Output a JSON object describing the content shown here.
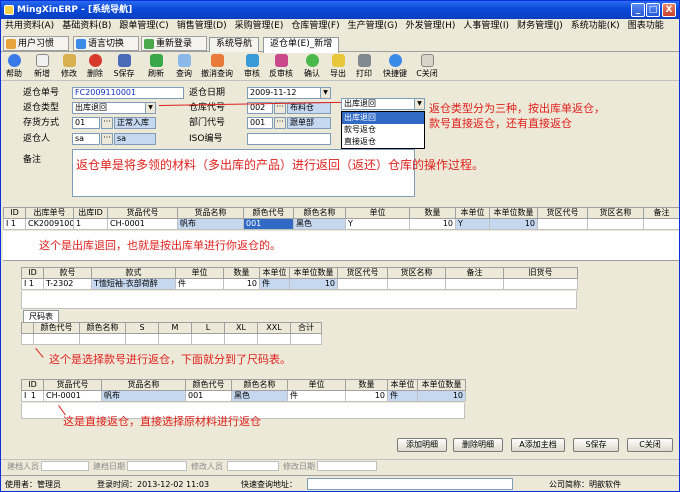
{
  "window": {
    "title": "MingXinERP - [系统导航]",
    "minimize": "_",
    "maximize": "□",
    "close": "X"
  },
  "menu": [
    "共用资料(A)",
    "基础资料(B)",
    "跟单管理(C)",
    "销售管理(D)",
    "采购管理(E)",
    "仓库管理(F)",
    "生产管理(G)",
    "外发管理(H)",
    "人事管理(I)",
    "财务管理(J)",
    "系统功能(K)",
    "图表功能"
  ],
  "quickbar": {
    "user_habit": "用户习惯",
    "language": "语言切换",
    "relogin": "重新登录"
  },
  "tabs": [
    "系统导航",
    "返仓单(E)_新增"
  ],
  "toolbar": [
    "帮助",
    "新增",
    "修改",
    "删除",
    "S保存",
    "刷新",
    "查询",
    "撤消查询",
    "审核",
    "反审核",
    "确认",
    "导出",
    "打印",
    "快捷键",
    "C关闭"
  ],
  "form": {
    "return_no_label": "返仓单号",
    "return_no": "FC2009110001",
    "return_date_label": "返仓日期",
    "return_date": "2009-11-12",
    "type_label": "返仓类型",
    "type_value": "出库退回",
    "warehouse_label": "仓库代号",
    "warehouse_code": "002",
    "warehouse_name": "布料仓",
    "stock_label": "存货方式",
    "stock_code": "01",
    "stock_name": "正常入库",
    "dept_label": "部门代号",
    "dept_code": "001",
    "dept_name": "跟单部",
    "person_label": "返仓人",
    "person_code": "sa",
    "person_name": "sa",
    "iso_label": "ISO编号",
    "iso_value": "",
    "remark_label": "备注"
  },
  "dropdown": {
    "selected": "出库退回",
    "options": [
      "出库退回",
      "款号返仓",
      "直接返仓"
    ]
  },
  "notes": {
    "type_info_1": "返仓类型分为三种，按出库单返仓，",
    "type_info_2": "款号直接返仓，还有直接返仓",
    "remark_info": "返仓单是将多领的材料（多出库的产品）进行返回（返还）仓库的操作过程。",
    "grid1_info": "这个是出库退回，也就是按出库单进行你返仓的。",
    "size_info": "这个是选择款号进行返仓，下面就分到了尺码表。",
    "grid3_info": "这是直接返仓，直接选择原材料进行返仓"
  },
  "grid1": {
    "headers": [
      "ID",
      "出库单号",
      "出库ID",
      "货品代号",
      "货品名称",
      "颜色代号",
      "颜色名称",
      "单位",
      "数量",
      "本单位",
      "本单位数量",
      "货区代号",
      "货区名称",
      "备注"
    ],
    "row": {
      "indicator": "I",
      "id": "1",
      "out_no": "CK2009100001",
      "out_id": "1",
      "code": "CH-0001",
      "name": "帆布",
      "color_code": "001",
      "color_name": "黑色",
      "unit": "Y",
      "qty": "10",
      "base_unit": "Y",
      "base_qty": "10",
      "area_code": "",
      "area_name": "",
      "remark": ""
    }
  },
  "grid2": {
    "headers": [
      "ID",
      "款号",
      "款式",
      "单位",
      "数量",
      "本单位",
      "本单位数量",
      "货区代号",
      "货区名称",
      "备注",
      "旧货号"
    ],
    "row": {
      "indicator": "I",
      "id": "1",
      "style_no": "T-2302",
      "style": "T恤短袖-衣部荷醉",
      "unit": "件",
      "qty": "10",
      "base_unit": "件",
      "base_qty": "10",
      "area_code": "",
      "area_name": "",
      "remark": "",
      "old_no": ""
    }
  },
  "size_table": {
    "title": "尺码表",
    "headers": [
      "颜色代号",
      "颜色名称",
      "S",
      "M",
      "L",
      "XL",
      "XXL",
      "合计"
    ]
  },
  "grid3": {
    "headers": [
      "ID",
      "货品代号",
      "货品名称",
      "颜色代号",
      "颜色名称",
      "单位",
      "数量",
      "本单位",
      "本单位数量"
    ],
    "row": {
      "indicator": "I",
      "id": "1",
      "code": "CH-0001",
      "name": "帆布",
      "color_code": "001",
      "color_name": "黑色",
      "unit": "件",
      "qty": "10",
      "base_unit": "件",
      "base_qty": "10"
    }
  },
  "buttons": {
    "add_detail": "添加明细",
    "delete_detail": "删除明细",
    "add_style": "A添加主档",
    "save": "S保存",
    "close": "C关闭"
  },
  "footer": {
    "creator": "建档人员",
    "create_date": "建档日期",
    "modifier": "修改人员",
    "modify_date": "修改日期"
  },
  "status": {
    "user": "使用者：管理员",
    "login_time": "登录时间：2013-12-02 11:03",
    "quick_query": "快速查询地址：",
    "company": "公司简称：明歆软件"
  },
  "colors": {
    "accent": "#0a48d8",
    "note_red": "#e0201c",
    "highlight": "#316ac5",
    "cell_blue": "#c6d8f0"
  }
}
